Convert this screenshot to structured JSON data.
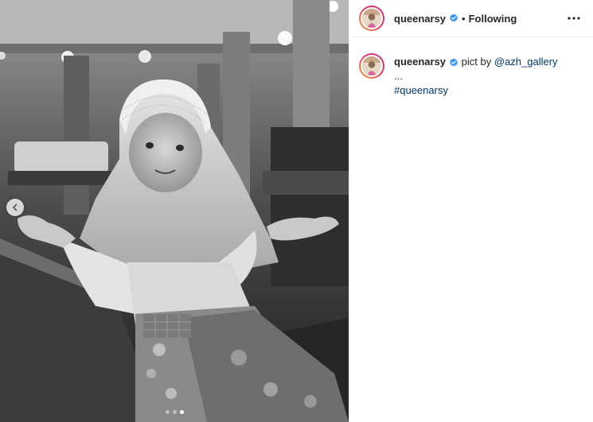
{
  "post": {
    "image_alt": "Black and white photo of a young girl in a white hijab sitting with palms raised",
    "carousel": {
      "total": 3,
      "active_index": 2
    }
  },
  "header": {
    "username": "queenarsy",
    "separator": "•",
    "follow_status": "Following",
    "more_icon": "ellipsis-horizontal-icon"
  },
  "caption": {
    "username": "queenarsy",
    "text": "pict by",
    "mention": "@azh_gallery",
    "ellipsis": "...",
    "hashtag": "#queenarsy"
  },
  "colors": {
    "verified": "#3897f0",
    "link": "#00376b",
    "text": "#262626",
    "divider": "#efefef"
  }
}
